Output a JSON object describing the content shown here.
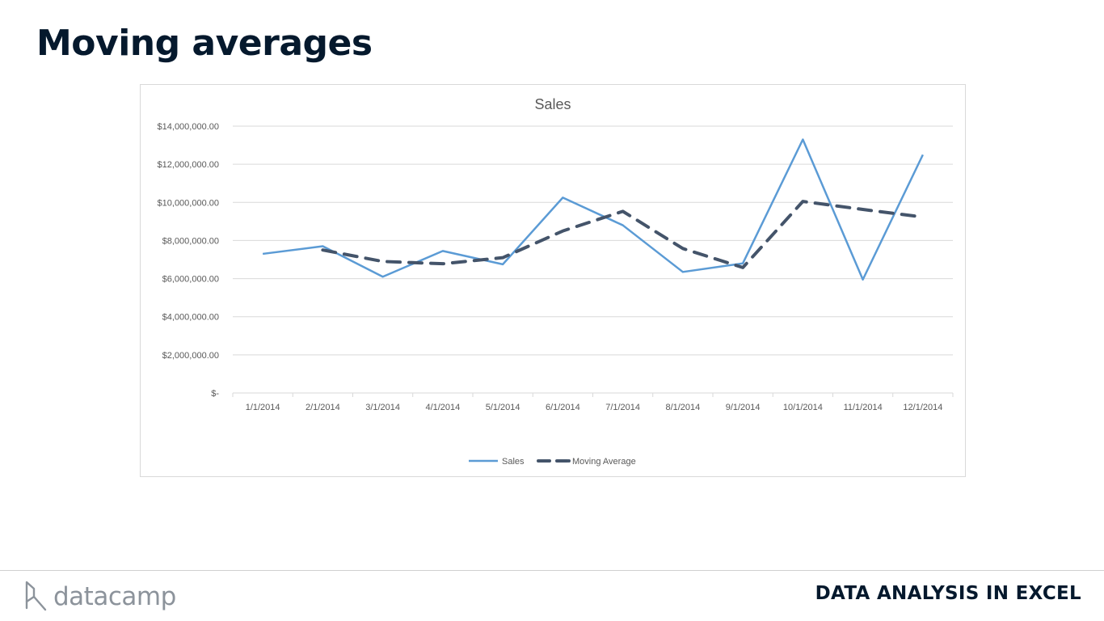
{
  "slide": {
    "title": "Moving averages"
  },
  "footer": {
    "brand": "datacamp",
    "course": "DATA ANALYSIS IN EXCEL",
    "logo_icon": "datacamp-logo-icon"
  },
  "chart_data": {
    "type": "line",
    "title": "Sales",
    "xlabel": "",
    "ylabel": "",
    "categories": [
      "1/1/2014",
      "2/1/2014",
      "3/1/2014",
      "4/1/2014",
      "5/1/2014",
      "6/1/2014",
      "7/1/2014",
      "8/1/2014",
      "9/1/2014",
      "10/1/2014",
      "11/1/2014",
      "12/1/2014"
    ],
    "ylim": [
      0,
      14000000
    ],
    "yticks": [
      0,
      2000000,
      4000000,
      6000000,
      8000000,
      10000000,
      12000000,
      14000000
    ],
    "ytick_labels": [
      "$-",
      "$2,000,000.00",
      "$4,000,000.00",
      "$6,000,000.00",
      "$8,000,000.00",
      "$10,000,000.00",
      "$12,000,000.00",
      "$14,000,000.00"
    ],
    "grid": true,
    "legend_position": "bottom",
    "series": [
      {
        "name": "Sales",
        "style": "solid",
        "color": "#5b9bd5",
        "values": [
          7300000,
          7700000,
          6100000,
          7450000,
          6750000,
          10250000,
          8800000,
          6350000,
          6800000,
          13300000,
          5950000,
          12500000
        ]
      },
      {
        "name": "Moving Average",
        "style": "dashed",
        "color": "#44546a",
        "values": [
          null,
          7500000,
          6900000,
          6780000,
          7100000,
          8500000,
          9530000,
          7580000,
          6580000,
          10050000,
          9630000,
          9230000
        ]
      }
    ]
  }
}
